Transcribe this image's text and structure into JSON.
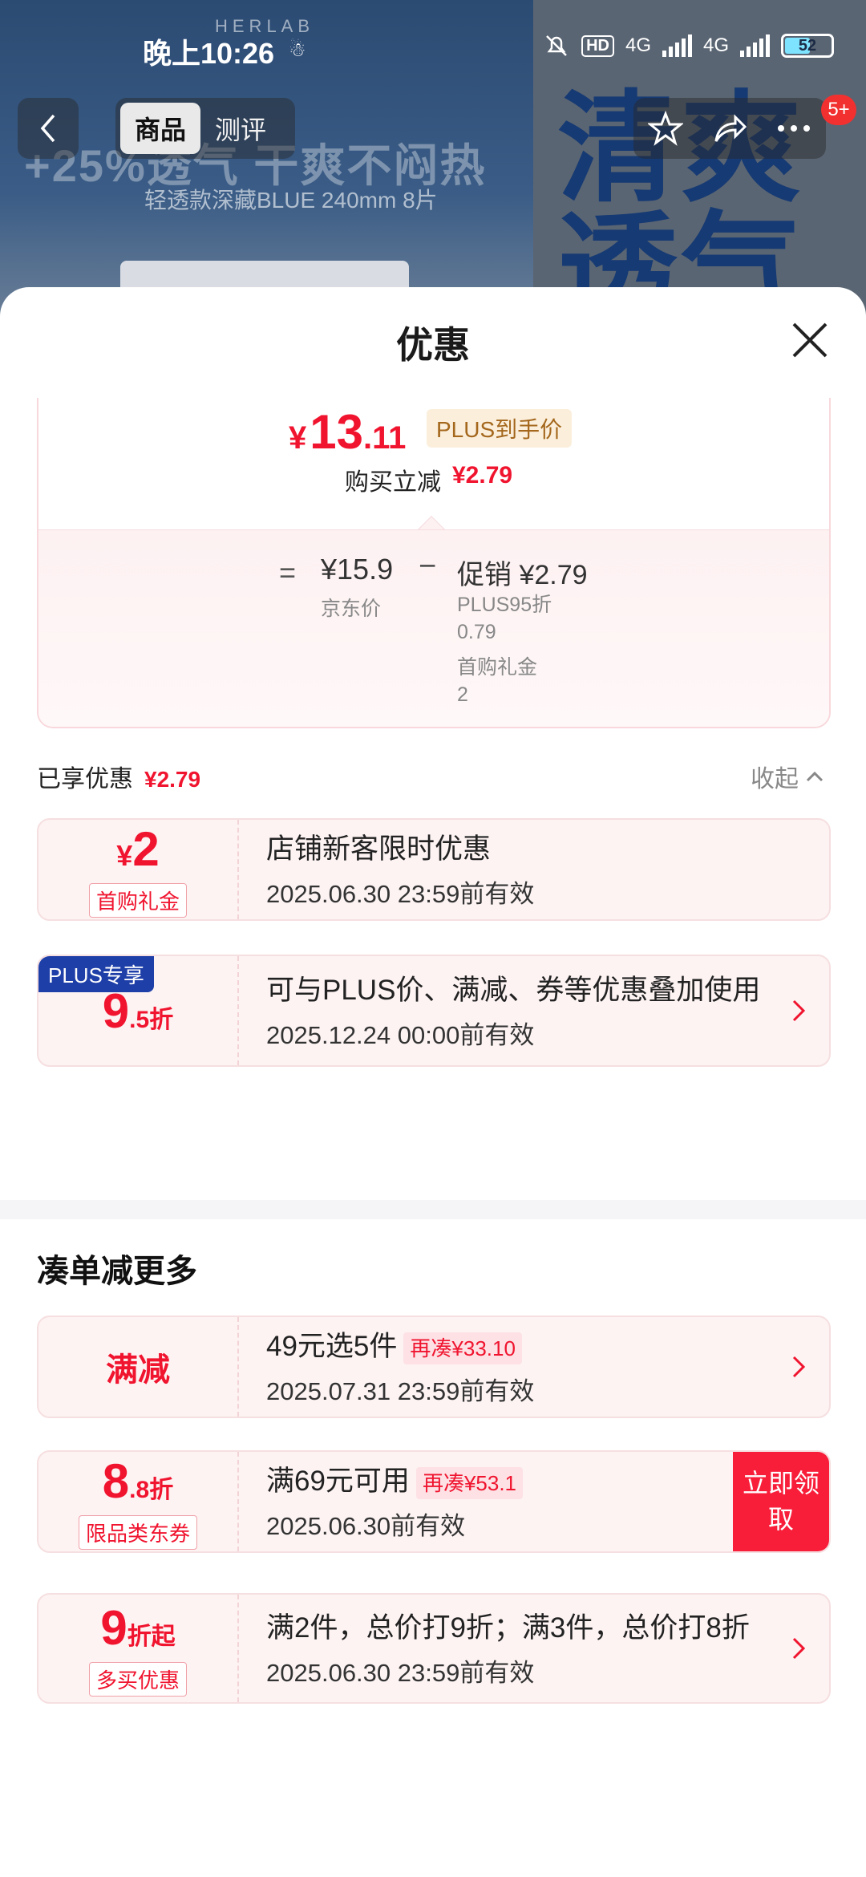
{
  "background": {
    "brand": "HERLAB",
    "headline": "+25%透气 干爽不闷热",
    "subline": "轻透款深藏BLUE 240mm 8片",
    "big_text": "清爽透气"
  },
  "status_bar": {
    "time": "晚上10:26",
    "net1": "4G",
    "net2": "4G",
    "hd": "HD",
    "battery": "52"
  },
  "nav": {
    "tabs": [
      "商品",
      "测评"
    ],
    "badge": "5+"
  },
  "sheet": {
    "title": "优惠"
  },
  "price": {
    "currency": "¥",
    "int": "13",
    "dec": ".11",
    "plus_tag": "PLUS到手价",
    "reduce_label": "购买立减",
    "reduce_value": "¥2.79",
    "eq": "=",
    "base_price": "¥15.9",
    "base_label": "京东价",
    "minus": "−",
    "promo_label": "促销 ¥2.79",
    "promo_items": [
      {
        "label": "PLUS95折",
        "value": "0.79"
      },
      {
        "label": "首购礼金",
        "value": "2"
      }
    ]
  },
  "enjoyed": {
    "label": "已享优惠",
    "value": "¥2.79",
    "collapse": "收起"
  },
  "coupons_enjoyed": [
    {
      "cur": "¥",
      "big": "2",
      "tag": "首购礼金",
      "title": "店铺新客限时优惠",
      "date": "2025.06.30 23:59前有效"
    },
    {
      "badge": "PLUS专享",
      "big": "9",
      "small": ".5折",
      "title": "可与PLUS价、满减、券等优惠叠加使用",
      "date": "2025.12.24 00:00前有效"
    }
  ],
  "more_section": {
    "title": "凑单减更多"
  },
  "coupons_more": [
    {
      "label": "满减",
      "title": "49元选5件",
      "pill": "再凑¥33.10",
      "date": "2025.07.31 23:59前有效"
    },
    {
      "big": "8",
      "small": ".8折",
      "tag": "限品类东券",
      "title": "满69元可用",
      "pill": "再凑¥53.1",
      "date": "2025.06.30前有效",
      "button": "立即领取"
    },
    {
      "big": "9",
      "small": "折起",
      "tag": "多买优惠",
      "title": "满2件，总价打9折；满3件，总价打8折",
      "date": "2025.06.30 23:59前有效"
    }
  ],
  "colors": {
    "accent_red": "#f0142f",
    "plus_blue": "#1f3fa8",
    "plus_gold_bg": "#fbefdc"
  }
}
